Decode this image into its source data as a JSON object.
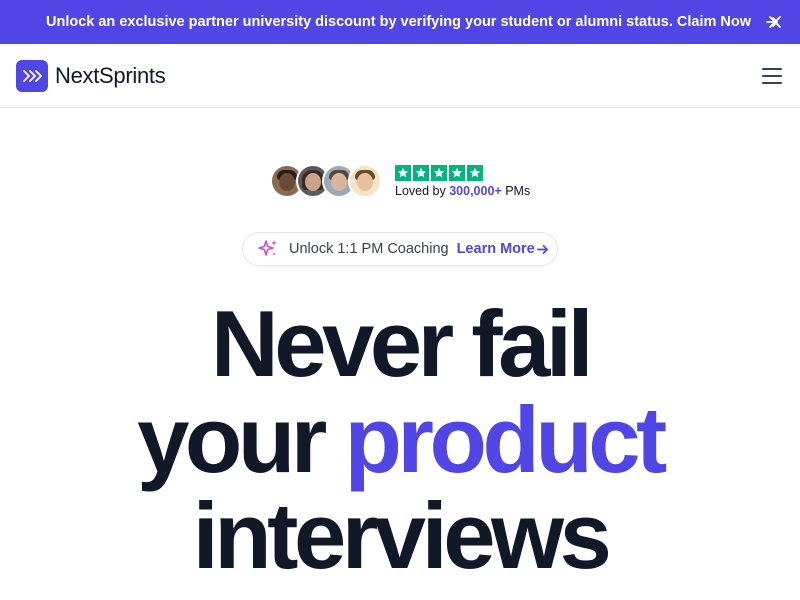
{
  "promo": {
    "text": "Unlock an exclusive partner university discount by verifying your student or alumni status. Claim Now",
    "arrow_icon": "arrow-right-icon",
    "close_icon": "close-icon",
    "background": "#4F46E5"
  },
  "nav": {
    "logo_text": "NextSprints",
    "logo_icon": "chevrons-right-icon",
    "menu_icon": "hamburger-menu-icon"
  },
  "social_proof": {
    "stars": 5,
    "loved_prefix": "Loved by",
    "loved_count": "300,000+",
    "loved_suffix": "PMs",
    "star_color": "#00B67A"
  },
  "coaching": {
    "icon": "sparkle-icon",
    "text": "Unlock 1:1 PM Coaching",
    "link": "Learn More"
  },
  "hero": {
    "line1": "Never fail",
    "line2_plain": "your",
    "line2_accent": "product",
    "line3": "interviews",
    "accent_color": "#4F46E5"
  }
}
